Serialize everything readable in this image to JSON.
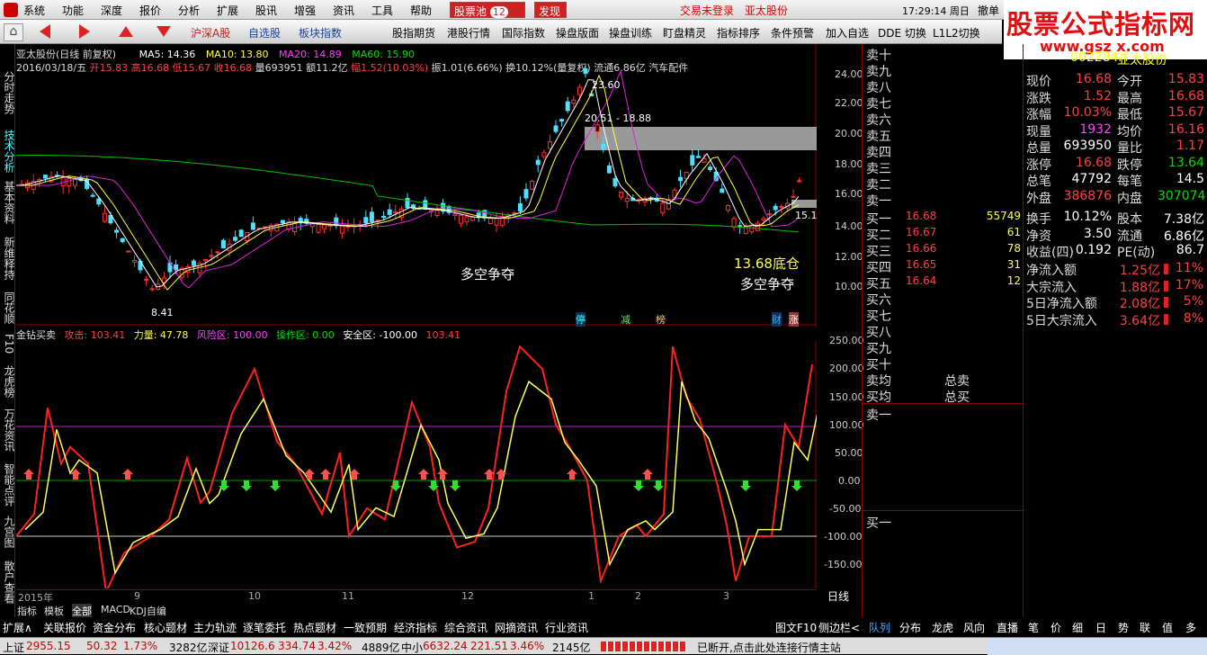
{
  "menubar": {
    "items": [
      "系统",
      "功能",
      "深度",
      "报价",
      "分析",
      "扩展",
      "股讯",
      "增强",
      "资讯",
      "工具",
      "帮助"
    ],
    "pool_label": "股票池",
    "pool_count": "12",
    "discover": "发现",
    "trade_status": "交易未登录",
    "stock_name": "亚太股份",
    "clock": "17:29:14 周日",
    "undo": "撤单"
  },
  "toolbar": {
    "items": [
      "沪深A股",
      "自选股",
      "板块指数",
      "股指期货",
      "港股行情",
      "国际指数",
      "操盘版面",
      "操盘训练",
      "盯盘精灵",
      "指标排序",
      "条件预警",
      "加入自选",
      "DDE 切换",
      "L1L2切换"
    ]
  },
  "banner": {
    "title": "股票公式指标网",
    "url": "www.gsz x.com"
  },
  "left_rail": [
    "分时走势",
    "技术分析",
    "基本资料",
    "新维释持",
    "同花顺",
    "F10",
    "龙虎榜",
    "万花资讯",
    "智能点评",
    "九宫图",
    "散户查看"
  ],
  "chart": {
    "header1": {
      "name": "亚太股份(日线 前复权)",
      "ma5": "MA5: 14.36",
      "ma10": "MA10: 13.80",
      "ma20": "MA20: 14.89",
      "ma60": "MA60: 15.90"
    },
    "header2": {
      "date": "2016/03/18/五",
      "open": "开15.83",
      "high": "高16.68",
      "low": "低15.67",
      "close": "收16.68",
      "vol": "量693951",
      "amt": "额11.2亿",
      "chg": "幅1.52(10.03%)",
      "amp": "振1.01(6.66%)",
      "turn": "换10.12%(量复权)",
      "flow": "流通6.86亿",
      "industry": "汽车配件"
    },
    "price_axis": [
      "24.00",
      "22.00",
      "20.00",
      "18.00",
      "16.00",
      "14.00",
      "12.00",
      "10.00"
    ],
    "annotations": {
      "high": "23.60",
      "range": "20.51 - 18.88",
      "low": "8.41",
      "right": "15.1",
      "a1": "多空争夺",
      "a2": "13.68底仓",
      "a3": "多空争夺"
    },
    "event_tags": [
      "停",
      "减",
      "榜",
      "财",
      "涨"
    ],
    "chart_data": {
      "type": "line",
      "title": "亚太股份(日线 前复权)",
      "series": [
        {
          "name": "MA5",
          "values": [
            14.36
          ]
        },
        {
          "name": "MA10",
          "values": [
            13.8
          ]
        },
        {
          "name": "MA20",
          "values": [
            14.89
          ]
        },
        {
          "name": "MA60",
          "values": [
            15.9
          ]
        }
      ]
    }
  },
  "indicator": {
    "title": "金钻买卖",
    "attack": "攻击: 103.41",
    "force": "力量: 47.78",
    "risk": "风险区: 100.00",
    "op": "操作区: 0.00",
    "safe": "安全区: -100.00",
    "last": "103.41",
    "axis": [
      "250.00",
      "200.00",
      "150.00",
      "100.00",
      "50.00",
      "0.00",
      "-50.00",
      "-100.00",
      "-150.00"
    ]
  },
  "time_axis": {
    "year": "2015年",
    "months": [
      "9",
      "10",
      "11",
      "12",
      "1",
      "2",
      "3"
    ],
    "period": "日线"
  },
  "bottom_tabs": {
    "left": [
      "指标",
      "模板",
      "全部",
      "MACD",
      "KDJ自编"
    ],
    "row2": [
      "扩展∧",
      "关联报价",
      "资金分布",
      "核心题材",
      "主力轨迹",
      "逐笔委托",
      "热点题材",
      "一致预期",
      "经济指标",
      "综合资讯",
      "网摘资讯",
      "行业资讯"
    ],
    "right": [
      "图文F10",
      "侧边栏<",
      "队列",
      "分布",
      "龙虎",
      "风向",
      "直播",
      "笔",
      "价",
      "细",
      "日",
      "势",
      "联",
      "值",
      "多"
    ]
  },
  "quote": {
    "code": "002284",
    "name": "亚太股份",
    "rows": [
      [
        "现价",
        "16.68",
        "今开",
        "15.83"
      ],
      [
        "涨跌",
        "1.52",
        "最高",
        "16.68"
      ],
      [
        "涨幅",
        "10.03%",
        "最低",
        "15.67"
      ],
      [
        "现量",
        "1932",
        "均价",
        "16.16"
      ],
      [
        "总量",
        "693950",
        "量比",
        "1.17"
      ],
      [
        "涨停",
        "16.68",
        "跌停",
        "13.64"
      ],
      [
        "总笔",
        "47792",
        "每笔",
        "14.5"
      ],
      [
        "外盘",
        "386876",
        "内盘",
        "307074"
      ]
    ],
    "rows2": [
      [
        "换手",
        "10.12%",
        "股本",
        "7.38亿"
      ],
      [
        "净资",
        "3.50",
        "流通",
        "6.86亿"
      ],
      [
        "收益(四)",
        "0.192",
        "PE(动)",
        "86.7"
      ]
    ],
    "flows": [
      [
        "净流入额",
        "1.25亿",
        "11%"
      ],
      [
        "大宗流入",
        "1.88亿",
        "17%"
      ],
      [
        "5日净流入额",
        "2.08亿",
        "5%"
      ],
      [
        "5日大宗流入",
        "3.64亿",
        "8%"
      ]
    ]
  },
  "orderbook": {
    "sells": [
      "卖十",
      "卖九",
      "卖八",
      "卖七",
      "卖六",
      "卖五",
      "卖四",
      "卖三",
      "卖二",
      "卖一"
    ],
    "buys": [
      [
        "买一",
        "16.68",
        "55749"
      ],
      [
        "买二",
        "16.67",
        "61"
      ],
      [
        "买三",
        "16.66",
        "78"
      ],
      [
        "买四",
        "16.65",
        "31"
      ],
      [
        "买五",
        "16.64",
        "12"
      ],
      [
        "买六",
        "",
        ""
      ],
      [
        "买七",
        "",
        ""
      ],
      [
        "买八",
        "",
        ""
      ],
      [
        "买九",
        "",
        ""
      ],
      [
        "买十",
        "",
        ""
      ]
    ],
    "avg_sell": "卖均",
    "avg_buy": "买均",
    "total_sell": "总卖",
    "total_buy": "总买",
    "s1": "卖一",
    "b1": "买一"
  },
  "status": {
    "sh": "上证",
    "sh_v": "2955.15",
    "sh_c": "50.32",
    "sh_p": "1.73%",
    "sh_a": "3282亿",
    "sz": "深证",
    "sz_v": "10126.6",
    "sz_c": "334.74",
    "sz_p": "3.42%",
    "sz_a": "4889亿",
    "zx": "中小",
    "zx_v": "6632.24",
    "zx_c": "221.51",
    "zx_p": "3.46%",
    "zx_a": "2145亿",
    "msg": "已断开,点击此处连接行情主站"
  }
}
